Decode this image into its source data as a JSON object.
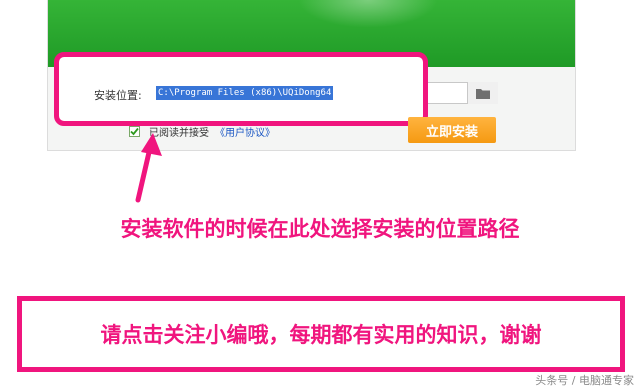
{
  "installer": {
    "path_label": "安装位置:",
    "path_value": "C:\\Program Files (x86)\\UQiDong64",
    "agree_text": "已阅读并接受",
    "agree_link": "《用户协议》",
    "agree_checked": true,
    "install_label": "立即安装"
  },
  "annotation": {
    "caption": "安装软件的时候在此处选择安装的位置路径",
    "notice": "请点击关注小编哦，每期都有实用的知识，谢谢"
  },
  "watermark": "头条号 / 电脑通专家",
  "colors": {
    "accent_pink": "#f0157e",
    "banner_green": "#2aa82e",
    "install_orange": "#f7a21c",
    "selection_blue": "#3875d7"
  },
  "icons": [
    "folder-icon",
    "check-icon",
    "arrow-up-icon"
  ]
}
